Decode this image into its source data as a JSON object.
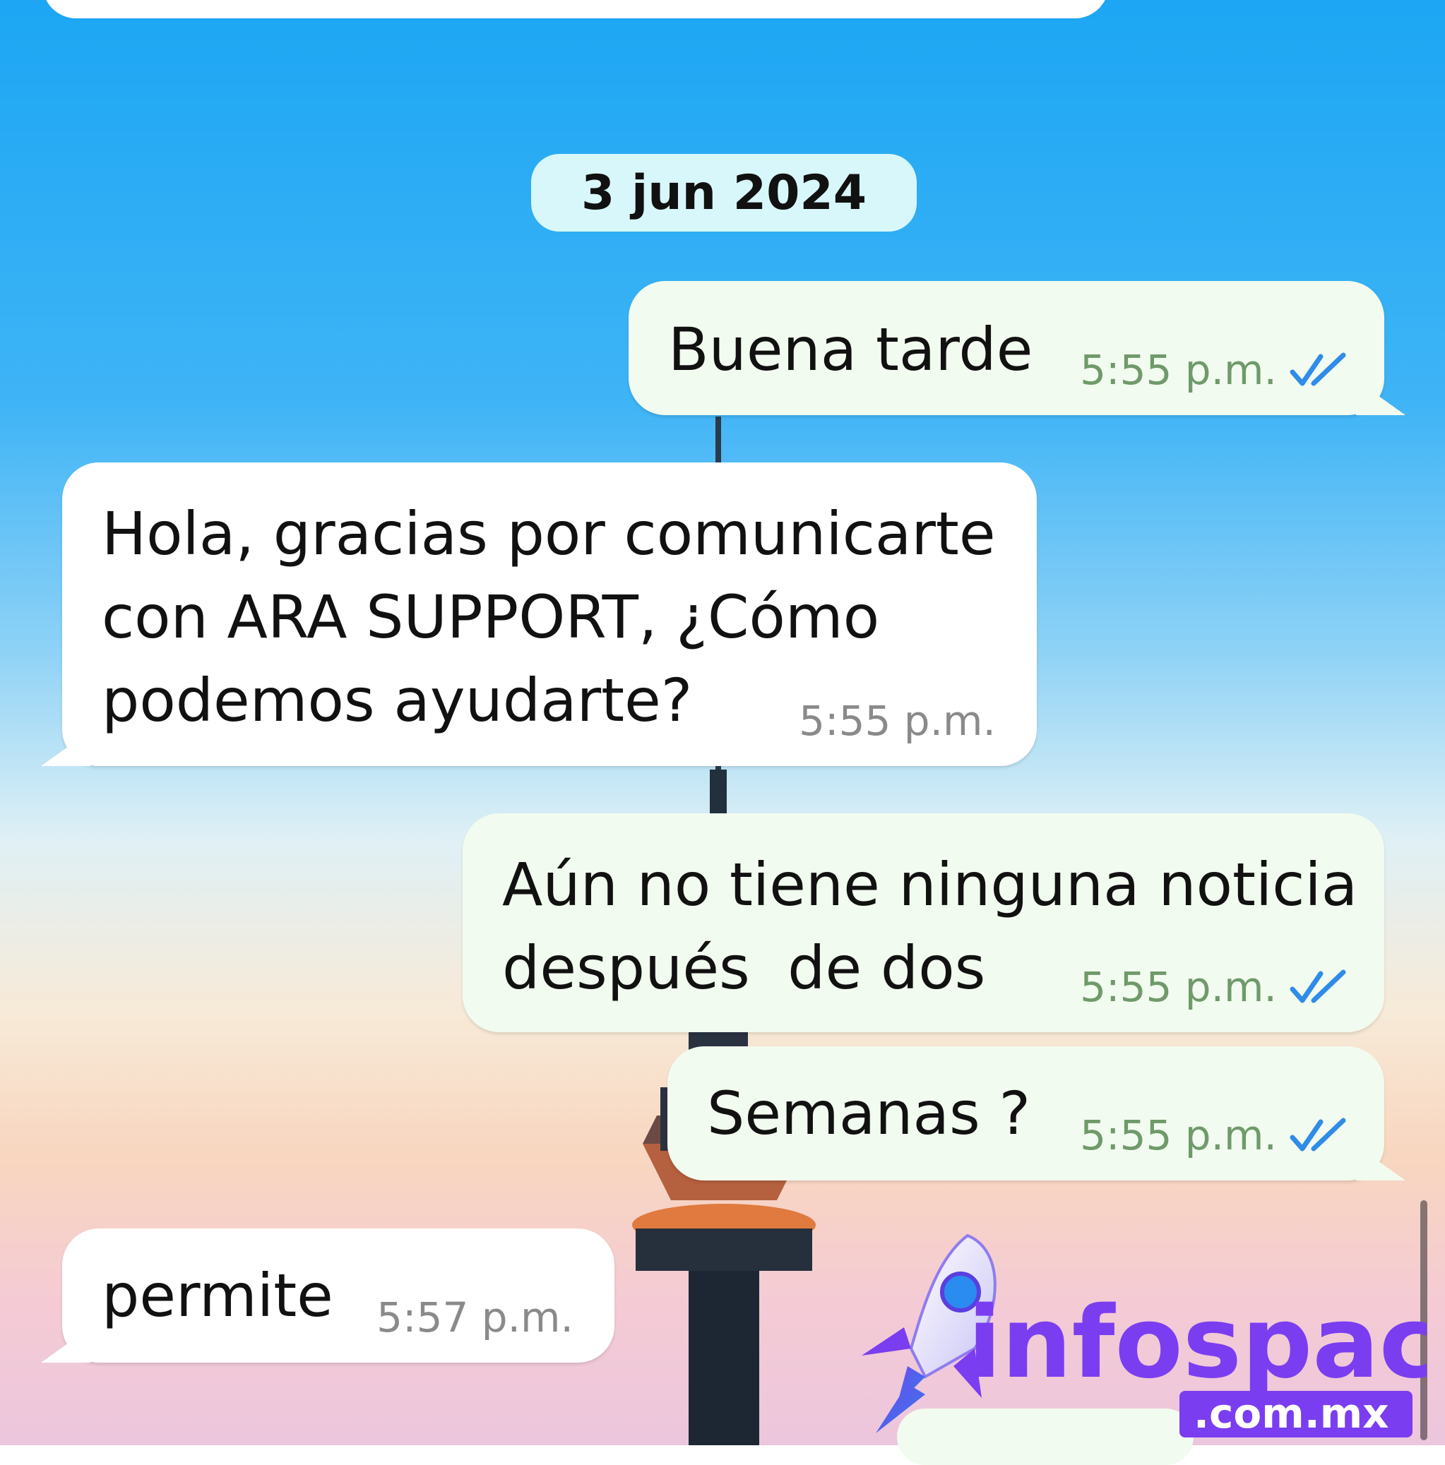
{
  "date_separator": "3 jun 2024",
  "messages": [
    {
      "direction": "outgoing",
      "lines": [
        "Buena tarde"
      ],
      "time": "5:55 p.m.",
      "status": "read-double-check-icon"
    },
    {
      "direction": "incoming",
      "lines": [
        "Hola, gracias por comunicarte",
        "con ARA SUPPORT, ¿Cómo",
        "podemos ayudarte?"
      ],
      "time": "5:55 p.m."
    },
    {
      "direction": "outgoing",
      "lines": [
        "Aún no tiene ninguna noticia",
        "después  de dos"
      ],
      "time": "5:55 p.m.",
      "status": "read-double-check-icon"
    },
    {
      "direction": "outgoing",
      "lines": [
        "Semanas ?"
      ],
      "time": "5:55 p.m.",
      "status": "read-double-check-icon"
    },
    {
      "direction": "incoming",
      "lines": [
        "permite"
      ],
      "time": "5:57 p.m."
    }
  ],
  "watermark": {
    "logo_icon": "rocket-icon",
    "brand": "infospace",
    "domain": ".com.mx"
  },
  "colors": {
    "sky_top": "#19a6f4",
    "sky_bottom": "#f3c9d8",
    "incoming_bubble": "#ffffff",
    "outgoing_bubble": "#f2fbef",
    "outgoing_time": "#6f9a6a",
    "read_ticks": "#2f8ce8",
    "date_chip": "#d8f7fb",
    "brand_purple": "#7b3df0"
  }
}
